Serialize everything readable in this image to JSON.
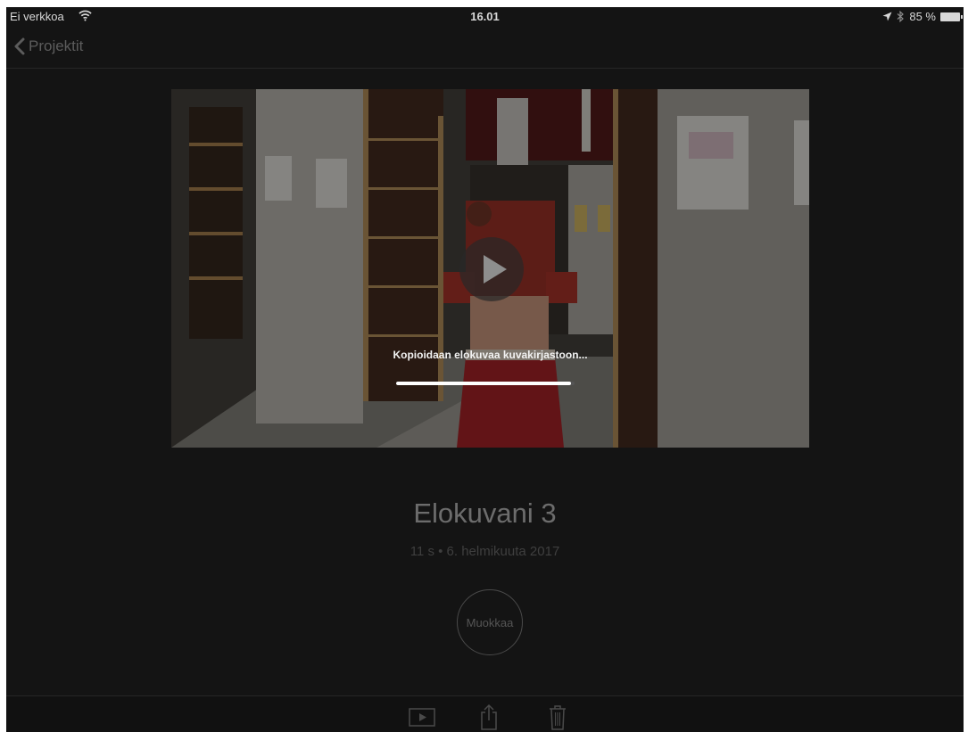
{
  "status_bar": {
    "carrier": "Ei verkkoa",
    "time": "16.01",
    "battery": "85 %",
    "icons": [
      "wifi-icon",
      "location-arrow-icon",
      "bluetooth-icon",
      "battery-icon"
    ]
  },
  "nav": {
    "back_label": "Projektit",
    "back_icon": "chevron-left-icon"
  },
  "video": {
    "copy_status": "Kopioidaan elokuvaa kuvakirjastoon...",
    "progress": 0.98,
    "play_icon": "play-icon"
  },
  "project": {
    "title": "Elokuvani 3",
    "meta": "11 s • 6. helmikuuta 2017",
    "edit_label": "Muokkaa"
  },
  "toolbar": {
    "icons": [
      "play-icon",
      "share-icon",
      "trash-icon"
    ]
  },
  "colors": {
    "background": "#141414",
    "title_text": "#6c6c6c",
    "accent_dim": "#5c5c5c"
  }
}
